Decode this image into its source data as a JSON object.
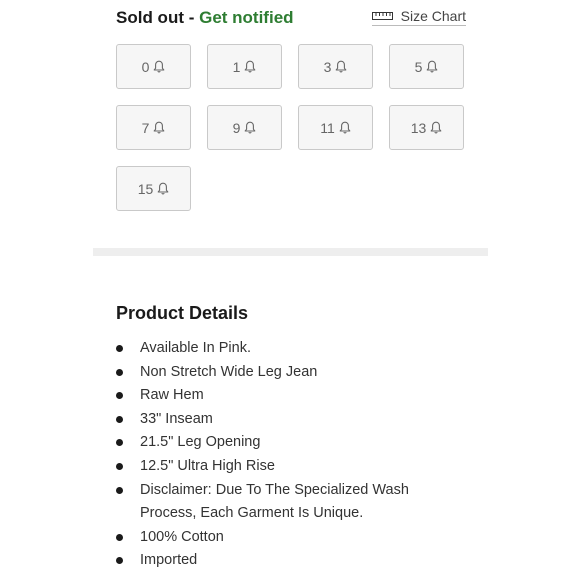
{
  "stock": {
    "status": "Sold out",
    "separator": " - ",
    "notify_label": "Get notified",
    "notify_color": "#2e7d32"
  },
  "size_chart": {
    "label": "Size Chart",
    "icon": "ruler-icon"
  },
  "sizes": [
    {
      "label": "0",
      "icon": "bell-icon"
    },
    {
      "label": "1",
      "icon": "bell-icon"
    },
    {
      "label": "3",
      "icon": "bell-icon"
    },
    {
      "label": "5",
      "icon": "bell-icon"
    },
    {
      "label": "7",
      "icon": "bell-icon"
    },
    {
      "label": "9",
      "icon": "bell-icon"
    },
    {
      "label": "11",
      "icon": "bell-icon"
    },
    {
      "label": "13",
      "icon": "bell-icon"
    },
    {
      "label": "15",
      "icon": "bell-icon"
    }
  ],
  "product_details": {
    "title": "Product Details",
    "items": [
      "Available In Pink.",
      "Non Stretch Wide Leg Jean",
      "Raw Hem",
      "33\" Inseam",
      "21.5\" Leg Opening",
      "12.5\" Ultra High Rise",
      "Disclaimer: Due To The Specialized Wash Process, Each Garment Is Unique.",
      "100% Cotton",
      "Imported"
    ]
  }
}
